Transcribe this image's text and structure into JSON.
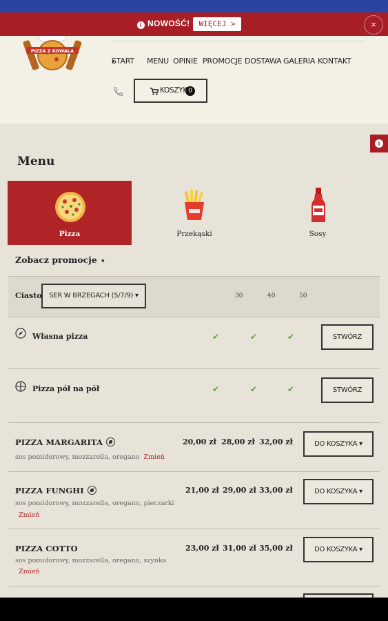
{
  "notice": {
    "text": "NOWOŚĆ!",
    "more_label": "WIĘCEJ >",
    "close_label": "×",
    "color": "#a81e26"
  },
  "header": {
    "logo_text": "PIZZA Z KOWALA",
    "nav": [
      "START",
      "MENU",
      "OPINIE",
      "PROMOCJE",
      "DOSTAWA",
      "GALERIA",
      "KONTAKT"
    ],
    "start_caret": "▾",
    "cart_label": "KOSZYK",
    "cart_count": "0"
  },
  "menu": {
    "title": "Menu",
    "categories": [
      {
        "name": "Pizza",
        "icon": "pizza-icon",
        "active": true
      },
      {
        "name": "Przekąski",
        "icon": "fries-icon",
        "active": false
      },
      {
        "name": "Sosy",
        "icon": "ketchup-bottle-icon",
        "active": false
      }
    ],
    "promo_label": "Zobacz promocje",
    "promo_caret": "▾"
  },
  "dough": {
    "label": "Ciasto",
    "selected": "SER W BRZEGACH (5/7/9) ▾",
    "sizes": [
      "30",
      "40",
      "50"
    ]
  },
  "custom": [
    {
      "name": "Własna pizza",
      "button": "STWÓRZ",
      "icon": "compass-icon",
      "checks": [
        "✔",
        "✔",
        "✔"
      ]
    },
    {
      "name": "Pizza pół na pół",
      "button": "STWÓRZ",
      "icon": "half-pizza-icon",
      "checks": [
        "✔",
        "✔",
        "✔"
      ]
    }
  ],
  "products": [
    {
      "name": "PIZZA MARGARITA",
      "veg": true,
      "desc": "sos pomidorowy, mozzarella, oregano",
      "change": "Zmień",
      "prices": [
        "20,00 zł",
        "28,00 zł",
        "32,00 zł"
      ],
      "button": "DO KOSZYKA ▾"
    },
    {
      "name": "PIZZA FUNGHI",
      "veg": true,
      "desc": "sos pomidorowy, mozzarella, oregano, pieczarki",
      "change": "Zmień",
      "prices": [
        "21,00 zł",
        "29,00 zł",
        "33,00 zł"
      ],
      "button": "DO KOSZYKA ▾"
    },
    {
      "name": "PIZZA COTTO",
      "veg": false,
      "desc": "sos pomidorowy, mozzarella, oregano, szynka",
      "change": "Zmień",
      "prices": [
        "23,00 zł",
        "31,00 zł",
        "35,00 zł"
      ],
      "button": "DO KOSZYKA ▾"
    }
  ]
}
